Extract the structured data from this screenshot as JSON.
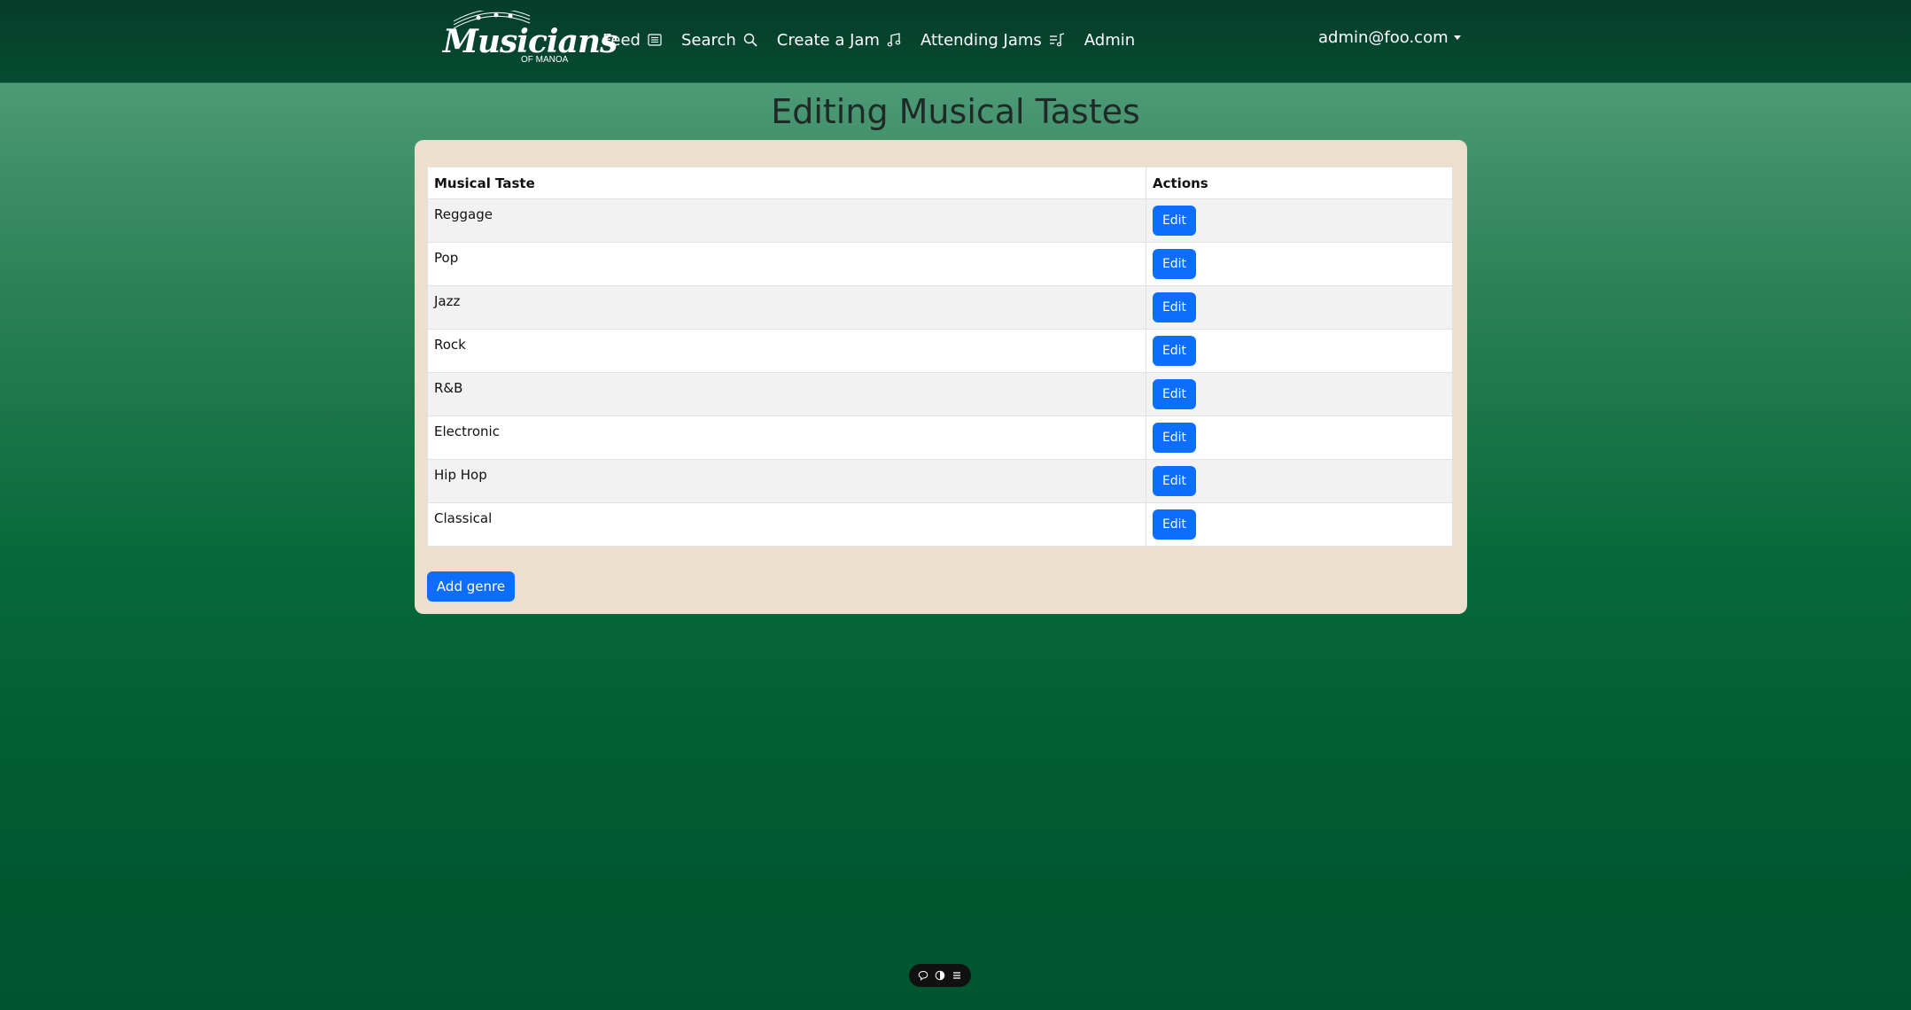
{
  "brand": {
    "logo_title": "Musicians",
    "logo_subtitle": "OF MANOA"
  },
  "nav": {
    "items": [
      {
        "label": "Feed",
        "icon": "feed-icon"
      },
      {
        "label": "Search",
        "icon": "search-icon"
      },
      {
        "label": "Create a Jam",
        "icon": "music-note-icon"
      },
      {
        "label": "Attending Jams",
        "icon": "music-playlist-icon"
      },
      {
        "label": "Admin",
        "icon": ""
      }
    ],
    "user": "admin@foo.com"
  },
  "page": {
    "title": "Editing Musical Tastes"
  },
  "table": {
    "headers": [
      "Musical Taste",
      "Actions"
    ],
    "rows": [
      {
        "taste": "Reggage",
        "action": "Edit"
      },
      {
        "taste": "Pop",
        "action": "Edit"
      },
      {
        "taste": "Jazz",
        "action": "Edit"
      },
      {
        "taste": "Rock",
        "action": "Edit"
      },
      {
        "taste": "R&B",
        "action": "Edit"
      },
      {
        "taste": "Electronic",
        "action": "Edit"
      },
      {
        "taste": "Hip Hop",
        "action": "Edit"
      },
      {
        "taste": "Classical",
        "action": "Edit"
      }
    ]
  },
  "add_button": "Add genre",
  "toolbar": {
    "icons": [
      "comment-icon",
      "toggle-icon",
      "menu-icon"
    ]
  },
  "colors": {
    "navbar": "#053d2a",
    "panel": "#ece0cd",
    "primary_button": "#0d6efd"
  }
}
